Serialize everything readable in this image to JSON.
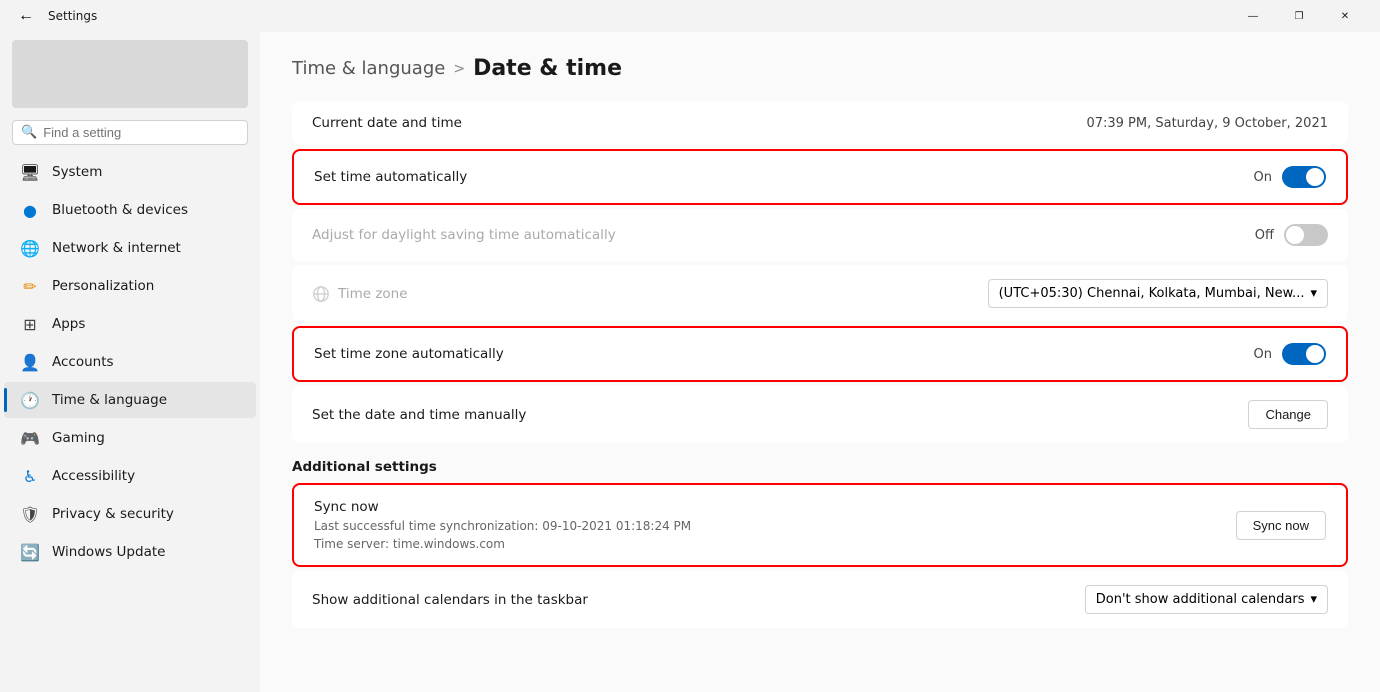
{
  "titlebar": {
    "back_label": "←",
    "title": "Settings",
    "min_label": "—",
    "max_label": "❐",
    "close_label": "✕"
  },
  "sidebar": {
    "search_placeholder": "Find a setting",
    "items": [
      {
        "id": "system",
        "label": "System",
        "icon": "🖥"
      },
      {
        "id": "bluetooth",
        "label": "Bluetooth & devices",
        "icon": "🔵"
      },
      {
        "id": "network",
        "label": "Network & internet",
        "icon": "🌐"
      },
      {
        "id": "personalization",
        "label": "Personalization",
        "icon": "✏️"
      },
      {
        "id": "apps",
        "label": "Apps",
        "icon": "📦"
      },
      {
        "id": "accounts",
        "label": "Accounts",
        "icon": "👤"
      },
      {
        "id": "time",
        "label": "Time & language",
        "icon": "🕐",
        "active": true
      },
      {
        "id": "gaming",
        "label": "Gaming",
        "icon": "🎮"
      },
      {
        "id": "accessibility",
        "label": "Accessibility",
        "icon": "♿"
      },
      {
        "id": "privacy",
        "label": "Privacy & security",
        "icon": "🛡"
      },
      {
        "id": "update",
        "label": "Windows Update",
        "icon": "🔄"
      }
    ]
  },
  "main": {
    "breadcrumb_parent": "Time & language",
    "breadcrumb_sep": ">",
    "breadcrumb_current": "Date & time",
    "current_date_label": "Current date and time",
    "current_date_value": "07:39 PM, Saturday, 9 October, 2021",
    "set_time_auto_label": "Set time automatically",
    "set_time_auto_state": "On",
    "set_time_auto_on": true,
    "daylight_label": "Adjust for daylight saving time automatically",
    "daylight_state": "Off",
    "daylight_on": false,
    "timezone_label": "Time zone",
    "timezone_value": "(UTC+05:30) Chennai, Kolkata, Mumbai, New...",
    "set_timezone_auto_label": "Set time zone automatically",
    "set_timezone_auto_state": "On",
    "set_timezone_auto_on": true,
    "set_manually_label": "Set the date and time manually",
    "change_btn_label": "Change",
    "additional_settings_header": "Additional settings",
    "sync_now_title": "Sync now",
    "sync_last": "Last successful time synchronization: 09-10-2021 01:18:24 PM",
    "sync_server": "Time server: time.windows.com",
    "sync_btn_label": "Sync now",
    "calendars_label": "Show additional calendars in the taskbar",
    "calendars_value": "Don't show additional calendars",
    "calendars_chevron": "▾"
  }
}
